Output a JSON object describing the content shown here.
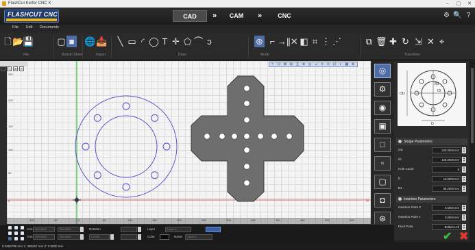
{
  "window": {
    "title": "FlashCut Kerfer CNC X",
    "controls": [
      "–",
      "▢",
      "✕"
    ]
  },
  "header": {
    "logo": "FLASHCUT CNC",
    "modes": [
      {
        "label": "CAD",
        "active": true
      },
      {
        "label": "CAM",
        "active": false
      },
      {
        "label": "CNC",
        "active": false
      }
    ],
    "separator": "»",
    "right_icons": [
      "gears-icon",
      "search-icon",
      "help-icon"
    ],
    "right_glyphs": [
      "⚙",
      "🔍",
      "?"
    ]
  },
  "menu": [
    "File",
    "Edit",
    "Documents"
  ],
  "toolbar": {
    "groups": [
      "File",
      "Bottom Sheet",
      "Import",
      "Draw",
      "Mode",
      "Transform"
    ],
    "icons": [
      "new-icon",
      "open-icon",
      "save-icon",
      "sheet-outline-icon",
      "sheet-fill-icon",
      "globe-icon",
      "import-icon",
      "line-icon",
      "rectangle-icon",
      "arc-icon",
      "circle-icon",
      "text-icon",
      "point-icon",
      "polygon-icon",
      "curve-icon",
      "spiral-icon",
      "select-mode-icon",
      "trim-icon",
      "extend-icon",
      "mirror-icon",
      "offset-icon",
      "array-icon",
      "distribute-icon",
      "align-icon",
      "copy-icon",
      "delete-icon",
      "move-icon",
      "rotate-icon",
      "scale-icon",
      "weld-icon",
      "explode-icon"
    ],
    "glyphs": [
      "🗋",
      "📂",
      "💾",
      "▢",
      "■",
      "🌐",
      "📥",
      "╲",
      "▭",
      "◜",
      "◯",
      "T",
      "✛",
      "⬠",
      "⌒",
      "ↄ",
      "⊛",
      "⌐",
      "→|",
      "|✕",
      "◧",
      "⌗",
      "⋮",
      "⋰",
      "⧉",
      "🗑",
      "✚",
      "↻",
      "⇲",
      "✕",
      "⌖"
    ]
  },
  "canvas": {
    "y_ticks": [
      "250",
      "200",
      "150",
      "100",
      "50",
      "0"
    ],
    "x_ticks": [
      "-100",
      "-50",
      "0",
      "50",
      "100",
      "150",
      "200",
      "250",
      "300",
      "350",
      "400",
      "450",
      "500",
      "550"
    ],
    "view_tools": [
      "⊡",
      "🔍",
      "⊞",
      "✕"
    ],
    "snap_tools": [
      "↖",
      "⊡",
      "⊠",
      "⊞",
      "╳",
      "⊕",
      "◎",
      "⊿",
      "✛",
      "⊙",
      "⊡",
      "◐",
      "▦",
      "⊗"
    ]
  },
  "shapes_palette": [
    "ring-flange",
    "gear-ring",
    "square-ring",
    "frame",
    "square",
    "slot",
    "rounded-square",
    "square-hole",
    "cross-circle"
  ],
  "shape_glyphs": [
    "◎",
    "⚙",
    "◉",
    "▣",
    "□",
    "▫",
    "▢",
    "◘",
    "⊛"
  ],
  "panel": {
    "preview_labels": [
      "OD",
      "ID",
      "B1",
      "D"
    ],
    "shape_parameters": {
      "title": "Shape Parameters",
      "rows": [
        {
          "label": "OD",
          "value": "225.0000 mm"
        },
        {
          "label": "ID",
          "value": "125.0000 mm"
        },
        {
          "label": "Hole Count",
          "value": "8"
        },
        {
          "label": "D",
          "value": "16.0000 mm"
        },
        {
          "label": "B1",
          "value": "86.2500 mm"
        }
      ]
    },
    "insertion_parameters": {
      "title": "Insertion Parameters",
      "rows": [
        {
          "label": "Insertion Point X",
          "value": "0.0000 mm"
        },
        {
          "label": "Insertion Point Y",
          "value": "0.0000 mm"
        },
        {
          "label": "Pivot Point",
          "value": "Bottom Left"
        }
      ]
    },
    "ok": "✔",
    "cancel": "✖"
  },
  "bottombar": {
    "labels": [
      "mm",
      "mm",
      "Rotation",
      "Layer",
      "Color",
      "Name"
    ],
    "values": [
      "200.0000",
      "350.0000",
      "200.0000",
      "350.0000",
      "0.0000",
      "Layer 0",
      "Layer 0"
    ],
    "layer_value": "Layer 0"
  },
  "status": "0.2954795 mm  Y: 485267 mm  Z: 0.0000 mm"
}
